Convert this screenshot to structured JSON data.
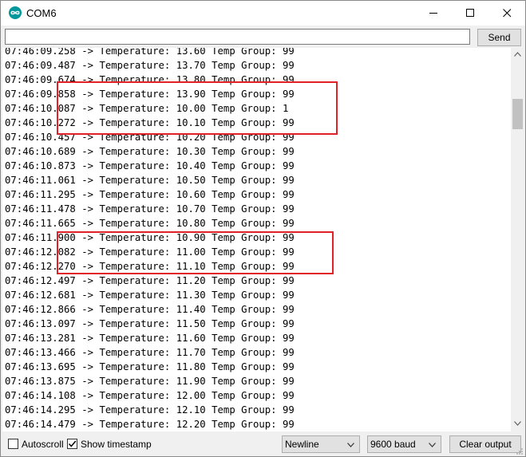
{
  "window": {
    "title": "COM6",
    "app_icon": "arduino-infinity-icon",
    "controls": [
      "minimize-icon",
      "maximize-icon",
      "close-icon"
    ]
  },
  "send_bar": {
    "input_value": "",
    "send_label": "Send"
  },
  "serial_output": {
    "lines": [
      "07:46:09.258 -> Temperature: 13.60 Temp Group: 99",
      "07:46:09.487 -> Temperature: 13.70 Temp Group: 99",
      "07:46:09.674 -> Temperature: 13.80 Temp Group: 99",
      "07:46:09.858 -> Temperature: 13.90 Temp Group: 99",
      "07:46:10.087 -> Temperature: 10.00 Temp Group: 1",
      "07:46:10.272 -> Temperature: 10.10 Temp Group: 99",
      "07:46:10.457 -> Temperature: 10.20 Temp Group: 99",
      "07:46:10.689 -> Temperature: 10.30 Temp Group: 99",
      "07:46:10.873 -> Temperature: 10.40 Temp Group: 99",
      "07:46:11.061 -> Temperature: 10.50 Temp Group: 99",
      "07:46:11.295 -> Temperature: 10.60 Temp Group: 99",
      "07:46:11.478 -> Temperature: 10.70 Temp Group: 99",
      "07:46:11.665 -> Temperature: 10.80 Temp Group: 99",
      "07:46:11.900 -> Temperature: 10.90 Temp Group: 99",
      "07:46:12.082 -> Temperature: 11.00 Temp Group: 99",
      "07:46:12.270 -> Temperature: 11.10 Temp Group: 99",
      "07:46:12.497 -> Temperature: 11.20 Temp Group: 99",
      "07:46:12.681 -> Temperature: 11.30 Temp Group: 99",
      "07:46:12.866 -> Temperature: 11.40 Temp Group: 99",
      "07:46:13.097 -> Temperature: 11.50 Temp Group: 99",
      "07:46:13.281 -> Temperature: 11.60 Temp Group: 99",
      "07:46:13.466 -> Temperature: 11.70 Temp Group: 99",
      "07:46:13.695 -> Temperature: 11.80 Temp Group: 99",
      "07:46:13.875 -> Temperature: 11.90 Temp Group: 99",
      "07:46:14.108 -> Temperature: 12.00 Temp Group: 99",
      "07:46:14.295 -> Temperature: 12.10 Temp Group: 99",
      "07:46:14.479 -> Temperature: 12.20 Temp Group: 99"
    ],
    "highlight_color": "#e02128"
  },
  "bottom_bar": {
    "autoscroll_label": "Autoscroll",
    "autoscroll_checked": false,
    "timestamp_label": "Show timestamp",
    "timestamp_checked": true,
    "line_ending_value": "Newline",
    "baud_value": "9600 baud",
    "clear_label": "Clear output"
  },
  "colors": {
    "arduino_teal": "#00979c",
    "chrome_bg": "#f0f0f0",
    "button_bg": "#e1e1e1"
  }
}
